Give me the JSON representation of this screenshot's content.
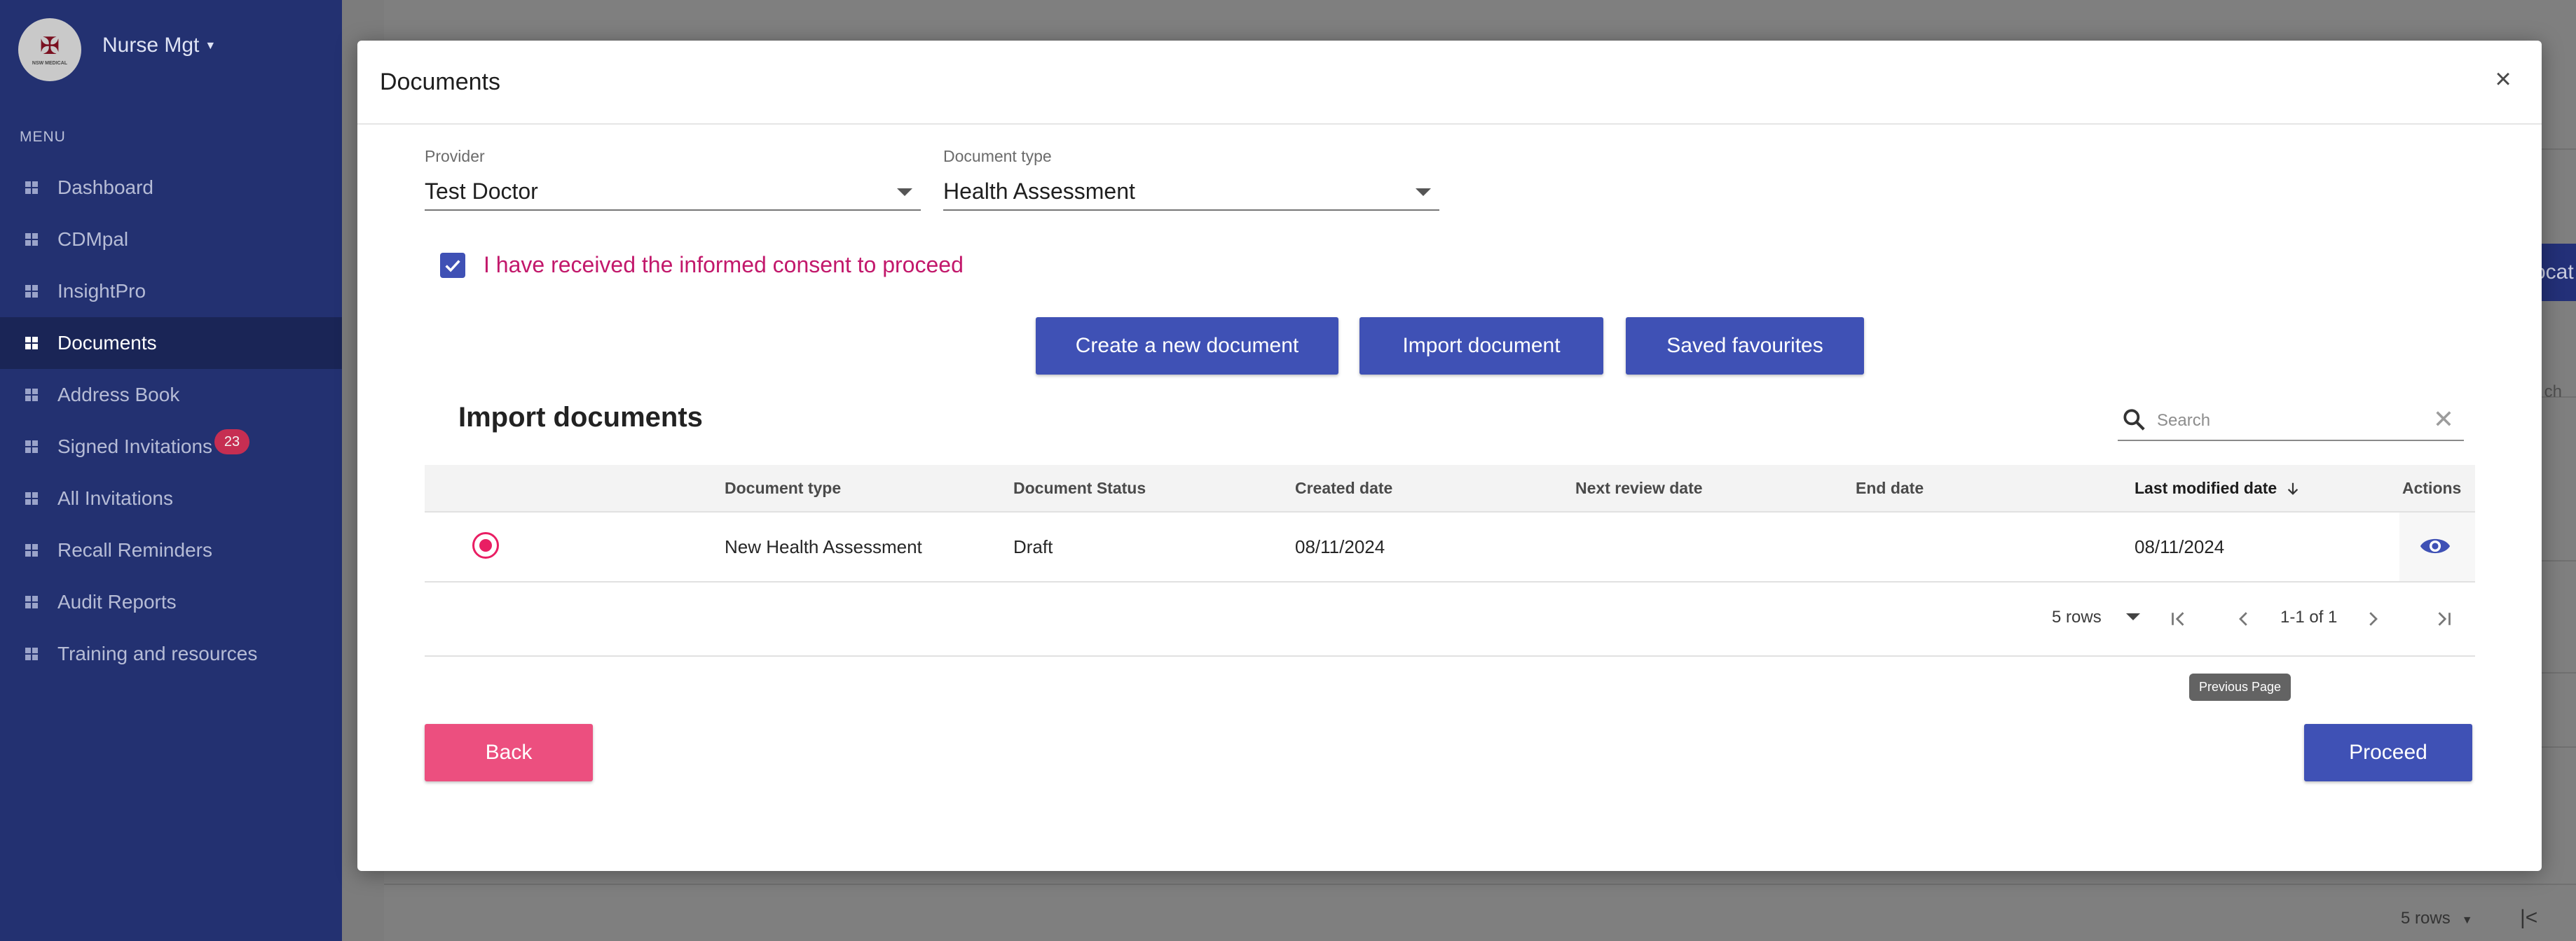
{
  "sidebar": {
    "org_name": "Nurse Mgt",
    "logo_text": "NSW MEDICAL",
    "menu_label": "MENU",
    "items": [
      {
        "label": "Dashboard"
      },
      {
        "label": "CDMpal"
      },
      {
        "label": "InsightPro"
      },
      {
        "label": "Documents",
        "active": true
      },
      {
        "label": "Address Book"
      },
      {
        "label": "Signed Invitations",
        "badge": "23"
      },
      {
        "label": "All Invitations"
      },
      {
        "label": "Recall Reminders"
      },
      {
        "label": "Audit Reports"
      },
      {
        "label": "Training and resources"
      }
    ]
  },
  "background": {
    "button_fragment": "ocat",
    "search_fragment": "ch",
    "rows_label": "5 rows"
  },
  "modal": {
    "title": "Documents",
    "close_symbol": "×",
    "provider": {
      "label": "Provider",
      "value": "Test Doctor"
    },
    "document_type": {
      "label": "Document type",
      "value": "Health Assessment"
    },
    "consent": {
      "text": "I have received the informed consent to proceed",
      "checked": true
    },
    "buttons": {
      "create": "Create a new document",
      "import": "Import document",
      "favourites": "Saved favourites"
    },
    "section_title": "Import documents",
    "search": {
      "placeholder": "Search",
      "clear_symbol": "✕"
    },
    "table": {
      "columns": [
        "Document type",
        "Document Status",
        "Created date",
        "Next review date",
        "End date",
        "Last modified date",
        "Actions"
      ],
      "rows": [
        {
          "document_type": "New Health Assessment",
          "status": "Draft",
          "created": "08/11/2024",
          "next_review": "",
          "end": "",
          "last_modified": "08/11/2024",
          "selected": true
        }
      ]
    },
    "pagination": {
      "rows_label": "5 rows",
      "range": "1-1 of 1",
      "tooltip": "Previous Page"
    },
    "back_label": "Back",
    "proceed_label": "Proceed"
  },
  "colors": {
    "sidebar_bg": "#233171",
    "primary": "#3f51b5",
    "accent_pink": "#ec4f7f",
    "consent_text": "#c2186b",
    "badge": "#c62e52"
  }
}
